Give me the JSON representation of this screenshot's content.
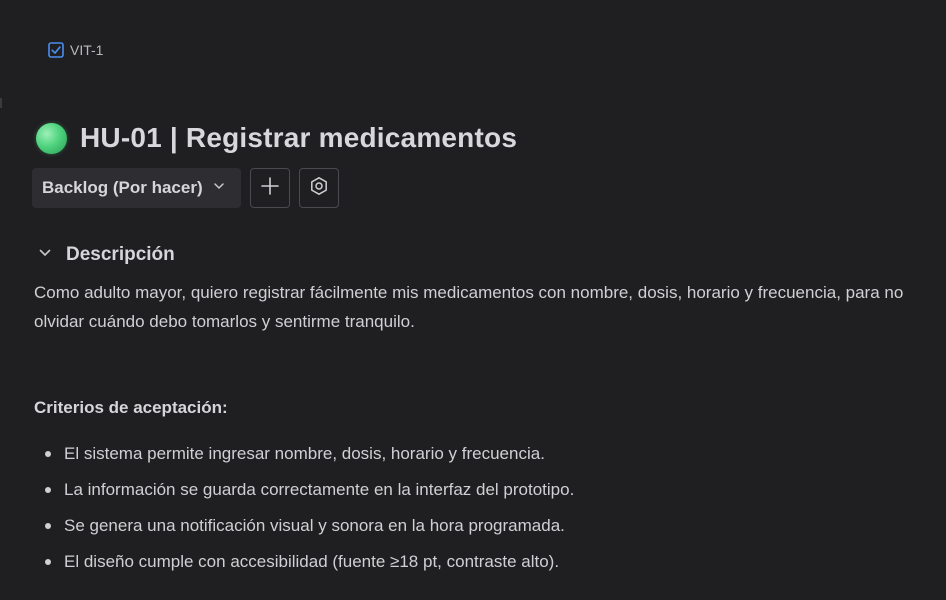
{
  "breadcrumb": {
    "issue_key": "VIT-1",
    "icon": "checkbox-icon"
  },
  "issue": {
    "title": "HU-01 | Registrar medicamentos",
    "status_color": "#4fd37e"
  },
  "toolbar": {
    "status_label": "Backlog (Por hacer)",
    "add_icon": "plus-icon",
    "settings_icon": "hexagon-settings-icon"
  },
  "description_section": {
    "heading": "Descripción",
    "text": "Como adulto mayor, quiero registrar fácilmente mis medicamentos con nombre, dosis, horario y frecuencia, para no olvidar cuándo debo tomarlos y sentirme tranquilo.",
    "criteria_heading": "Criterios de aceptación:",
    "criteria": [
      "El sistema permite ingresar nombre, dosis, horario y frecuencia.",
      "La información se guarda correctamente en la interfaz del prototipo.",
      "Se genera una notificación visual y sonora en la hora programada.",
      "El diseño cumple con accesibilidad (fuente ≥18 pt, contraste alto)."
    ]
  },
  "colors": {
    "background": "#1f1f21",
    "accent": "#4a8ef0",
    "text": "#d0d0d4"
  }
}
